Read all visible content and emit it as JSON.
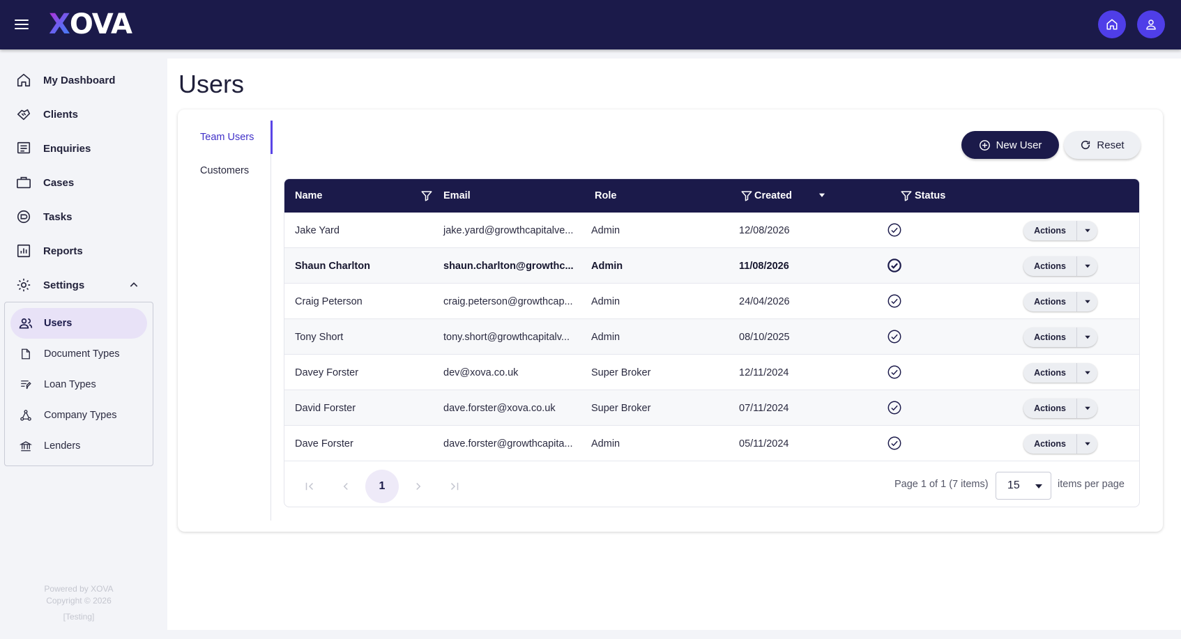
{
  "app": {
    "logo_x": "X",
    "logo_rest": "OVA"
  },
  "header": {
    "home_icon": "home-icon",
    "user_icon": "user-icon"
  },
  "sidebar": {
    "items": [
      {
        "label": "My Dashboard",
        "icon": "home-icon"
      },
      {
        "label": "Clients",
        "icon": "handshake-icon"
      },
      {
        "label": "Enquiries",
        "icon": "list-icon"
      },
      {
        "label": "Cases",
        "icon": "briefcase-icon"
      },
      {
        "label": "Tasks",
        "icon": "tasks-icon"
      },
      {
        "label": "Reports",
        "icon": "chart-icon"
      },
      {
        "label": "Settings",
        "icon": "gear-icon"
      }
    ],
    "settings_sub": [
      {
        "label": "Users",
        "icon": "users-icon",
        "active": true
      },
      {
        "label": "Document Types",
        "icon": "document-icon"
      },
      {
        "label": "Loan Types",
        "icon": "loan-icon"
      },
      {
        "label": "Company Types",
        "icon": "hierarchy-icon"
      },
      {
        "label": "Lenders",
        "icon": "bank-icon"
      }
    ],
    "footer": {
      "line1": "Powered by XOVA",
      "line2": "Copyright © 2026",
      "line3": "[Testing]"
    }
  },
  "page": {
    "title": "Users"
  },
  "tabs": [
    {
      "label": "Team Users",
      "active": true
    },
    {
      "label": "Customers"
    }
  ],
  "toolbar": {
    "new_user_label": "New User",
    "reset_label": "Reset"
  },
  "table": {
    "columns": [
      "Name",
      "Email",
      "Role",
      "Created",
      "Status"
    ],
    "rows": [
      {
        "name": "Jake Yard",
        "email": "jake.yard@growthcapitalve...",
        "role": "Admin",
        "created": "12/08/2026"
      },
      {
        "name": "Shaun Charlton",
        "email": "shaun.charlton@growthc...",
        "role": "Admin",
        "created": "11/08/2026"
      },
      {
        "name": "Craig Peterson",
        "email": "craig.peterson@growthcap...",
        "role": "Admin",
        "created": "24/04/2026"
      },
      {
        "name": "Tony Short",
        "email": "tony.short@growthcapitalv...",
        "role": "Admin",
        "created": "08/10/2025"
      },
      {
        "name": "Davey Forster",
        "email": "dev@xova.co.uk",
        "role": "Super Broker",
        "created": "12/11/2024"
      },
      {
        "name": "David Forster",
        "email": "dave.forster@xova.co.uk",
        "role": "Super Broker",
        "created": "07/11/2024"
      },
      {
        "name": "Dave Forster",
        "email": "dave.forster@growthcapita...",
        "role": "Admin",
        "created": "05/11/2024"
      }
    ],
    "actions_label": "Actions"
  },
  "pager": {
    "current_page": "1",
    "info": "Page 1 of 1 (7 items)",
    "page_size": "15",
    "per_page_label": "items per page"
  },
  "colors": {
    "navy": "#1b1a4a",
    "accent": "#5a45e6",
    "top_button": "#4f3ee8"
  }
}
